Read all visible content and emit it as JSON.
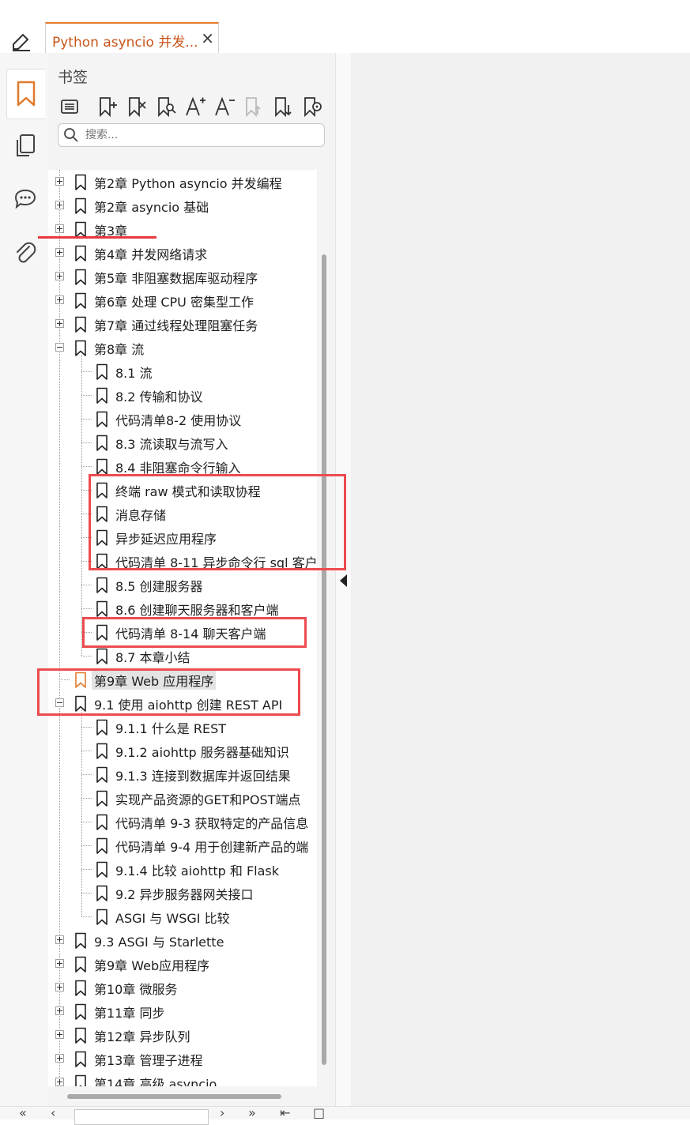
{
  "tab": {
    "title": "Python asyncio 并发...",
    "close": "×"
  },
  "panel": {
    "title": "书签"
  },
  "search": {
    "placeholder": "搜索..."
  },
  "tree": [
    {
      "label": "第2章 Python asyncio 并发编程",
      "level": 0,
      "expander": "plus"
    },
    {
      "label": "第2章 asyncio 基础",
      "level": 0,
      "expander": "plus"
    },
    {
      "label": "第3章",
      "level": 0,
      "expander": "plus"
    },
    {
      "label": "第4章 并发网络请求",
      "level": 0,
      "expander": "plus"
    },
    {
      "label": "第5章 非阻塞数据库驱动程序",
      "level": 0,
      "expander": "plus"
    },
    {
      "label": "第6章 处理 CPU 密集型工作",
      "level": 0,
      "expander": "plus"
    },
    {
      "label": "第7章 通过线程处理阻塞任务",
      "level": 0,
      "expander": "plus"
    },
    {
      "label": "第8章 流",
      "level": 0,
      "expander": "minus"
    },
    {
      "label": "8.1 流",
      "level": 1
    },
    {
      "label": "8.2 传输和协议",
      "level": 1
    },
    {
      "label": "代码清单8-2 使用协议",
      "level": 1
    },
    {
      "label": "8.3 流读取与流写入",
      "level": 1
    },
    {
      "label": "8.4 非阻塞命令行输入",
      "level": 1
    },
    {
      "label": "终端 raw 模式和读取协程",
      "level": 1
    },
    {
      "label": "消息存储",
      "level": 1
    },
    {
      "label": "异步延迟应用程序",
      "level": 1
    },
    {
      "label": "代码清单 8-11 异步命令行 sql 客户",
      "level": 1
    },
    {
      "label": "8.5 创建服务器",
      "level": 1
    },
    {
      "label": "8.6 创建聊天服务器和客户端",
      "level": 1
    },
    {
      "label": "代码清单 8-14 聊天客户端",
      "level": 1
    },
    {
      "label": "8.7 本章小结",
      "level": 1
    },
    {
      "label": "第9章 Web 应用程序",
      "level": 0,
      "selected": true
    },
    {
      "label": "9.1 使用 aiohttp 创建 REST API",
      "level": 0,
      "expander": "minus"
    },
    {
      "label": "9.1.1 什么是 REST",
      "level": 1
    },
    {
      "label": "9.1.2 aiohttp 服务器基础知识",
      "level": 1
    },
    {
      "label": "9.1.3 连接到数据库并返回结果",
      "level": 1
    },
    {
      "label": "实现产品资源的GET和POST端点",
      "level": 1
    },
    {
      "label": "代码清单 9-3 获取特定的产品信息",
      "level": 1
    },
    {
      "label": "代码清单 9-4 用于创建新产品的端",
      "level": 1
    },
    {
      "label": "9.1.4 比较 aiohttp 和 Flask",
      "level": 1
    },
    {
      "label": "9.2 异步服务器网关接口",
      "level": 1
    },
    {
      "label": "ASGI 与 WSGI 比较",
      "level": 1
    },
    {
      "label": "9.3 ASGI 与 Starlette",
      "level": 0,
      "expander": "plus"
    },
    {
      "label": "第9章 Web应用程序",
      "level": 0,
      "expander": "plus"
    },
    {
      "label": "第10章 微服务",
      "level": 0,
      "expander": "plus"
    },
    {
      "label": "第11章 同步",
      "level": 0,
      "expander": "plus"
    },
    {
      "label": "第12章 异步队列",
      "level": 0,
      "expander": "plus"
    },
    {
      "label": "第13章 管理子进程",
      "level": 0,
      "expander": "plus"
    },
    {
      "label": "第14章 高级 asyncio",
      "level": 0,
      "expander": "plus"
    }
  ],
  "colors": {
    "accent": "#c9541a",
    "annotation": "#e8383d",
    "bookmark_selected": "#e07a2c"
  },
  "icons": {
    "rail": [
      "bookmark-icon",
      "pages-icon",
      "comments-icon",
      "attachment-icon"
    ],
    "toolbar": [
      "outline-list-icon",
      "add-bookmark-icon",
      "delete-bookmark-icon",
      "find-bookmark-icon",
      "increase-font-icon",
      "decrease-font-icon",
      "promote-bookmark-icon",
      "demote-bookmark-icon",
      "bookmark-settings-icon"
    ]
  }
}
